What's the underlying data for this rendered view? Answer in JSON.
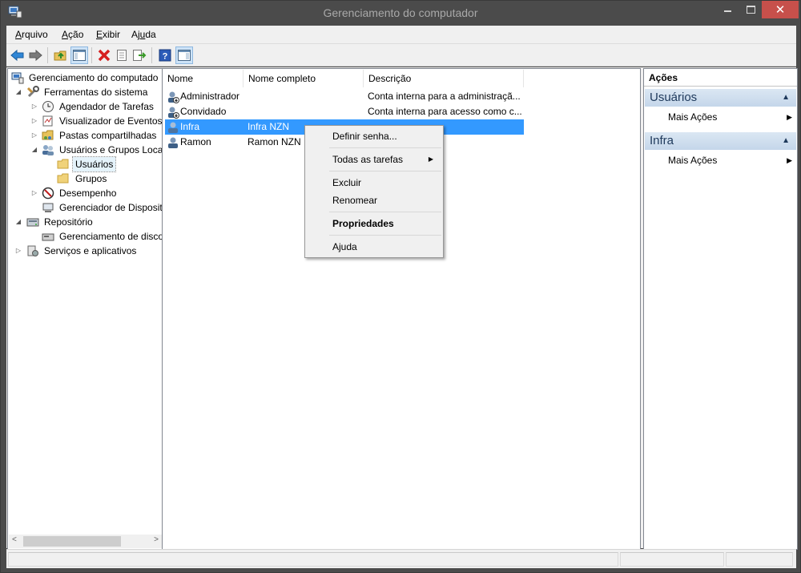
{
  "window": {
    "title": "Gerenciamento do computador",
    "close_glyph": "✕"
  },
  "menu": [
    {
      "prefix": "",
      "underline": "A",
      "rest": "rquivo"
    },
    {
      "prefix": "",
      "underline": "A",
      "rest": "ção"
    },
    {
      "prefix": "",
      "underline": "E",
      "rest": "xibir"
    },
    {
      "prefix": "Aj",
      "underline": "u",
      "rest": "da"
    }
  ],
  "toolbar": {
    "icons": [
      "back-arrow-icon",
      "forward-arrow-icon",
      "up-folder-icon",
      "show-hide-console-tree-icon",
      "delete-icon",
      "properties-icon",
      "export-list-icon",
      "help-icon",
      "show-hide-action-pane-icon"
    ]
  },
  "tree": {
    "items": [
      {
        "label": "Gerenciamento do computado",
        "expander": ""
      },
      {
        "label": "Ferramentas do sistema",
        "expander": "◢"
      },
      {
        "label": "Agendador de Tarefas",
        "expander": "▷"
      },
      {
        "label": "Visualizador de Eventos",
        "expander": "▷"
      },
      {
        "label": "Pastas compartilhadas",
        "expander": "▷"
      },
      {
        "label": "Usuários e Grupos Loca",
        "expander": "◢"
      },
      {
        "label": "Usuários",
        "expander": ""
      },
      {
        "label": "Grupos",
        "expander": ""
      },
      {
        "label": "Desempenho",
        "expander": "▷"
      },
      {
        "label": "Gerenciador de Disposit",
        "expander": ""
      },
      {
        "label": "Repositório",
        "expander": "◢"
      },
      {
        "label": "Gerenciamento de disco",
        "expander": ""
      },
      {
        "label": "Serviços e aplicativos",
        "expander": "▷"
      }
    ],
    "scroll_left": "<",
    "scroll_right": ">"
  },
  "list": {
    "columns": [
      "Nome",
      "Nome completo",
      "Descrição"
    ],
    "rows": [
      {
        "name": "Administrador",
        "fullname": "",
        "description": "Conta interna para a administraçã..."
      },
      {
        "name": "Convidado",
        "fullname": "",
        "description": "Conta interna para acesso como c..."
      },
      {
        "name": "Infra",
        "fullname": "Infra NZN",
        "description": ""
      },
      {
        "name": "Ramon",
        "fullname": "Ramon NZN",
        "description": ""
      }
    ]
  },
  "context_menu": {
    "items": [
      {
        "label": "Definir senha..."
      },
      {
        "label": "Todas as tarefas",
        "arrow": "▶"
      },
      {
        "label": "Excluir"
      },
      {
        "label": "Renomear"
      },
      {
        "label": "Propriedades"
      },
      {
        "label": "Ajuda"
      }
    ]
  },
  "actions": {
    "title": "Ações",
    "sections": [
      {
        "title": "Usuários",
        "item": "Mais Ações",
        "collapse_glyph": "▲",
        "sub_glyph": "▶"
      },
      {
        "title": "Infra",
        "item": "Mais Ações",
        "collapse_glyph": "▲",
        "sub_glyph": "▶"
      }
    ]
  }
}
